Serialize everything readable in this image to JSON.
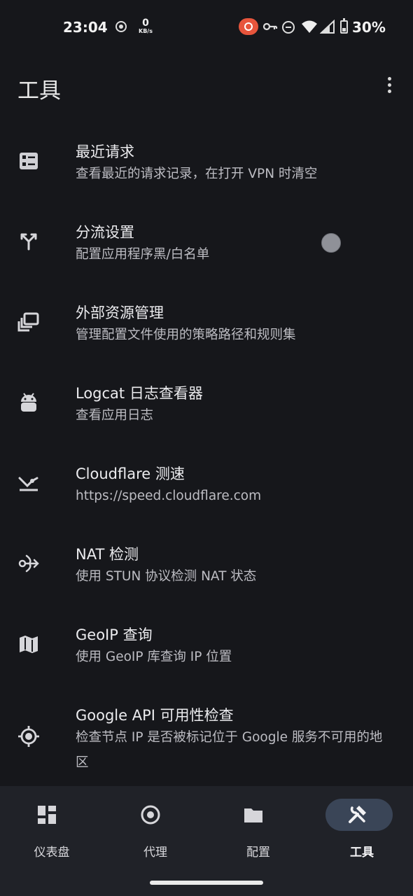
{
  "status_bar": {
    "time": "23:04",
    "net_speed_value": "0",
    "net_speed_unit": "KB/s",
    "battery": "30%",
    "icons": [
      "screen-record-icon",
      "cast-recording-icon",
      "vpn-key-icon",
      "do-not-disturb-icon",
      "wifi-icon",
      "signal-icon",
      "battery-icon"
    ]
  },
  "app_bar": {
    "title": "工具",
    "menu_icon": "more-vert-icon"
  },
  "tools": [
    {
      "icon": "request-list-icon",
      "title": "最近请求",
      "subtitle": "查看最近的请求记录，在打开 VPN 时清空"
    },
    {
      "icon": "call-split-icon",
      "title": "分流设置",
      "subtitle": "配置应用程序黑/白名单"
    },
    {
      "icon": "library-icon",
      "title": "外部资源管理",
      "subtitle": "管理配置文件使用的策略路径和规则集"
    },
    {
      "icon": "android-icon",
      "title": "Logcat 日志查看器",
      "subtitle": "查看应用日志"
    },
    {
      "icon": "speed-test-icon",
      "title": "Cloudflare 测速",
      "subtitle": "https://speed.cloudflare.com"
    },
    {
      "icon": "nat-icon",
      "title": "NAT 检测",
      "subtitle": "使用 STUN 协议检测 NAT 状态"
    },
    {
      "icon": "map-icon",
      "title": "GeoIP 查询",
      "subtitle": "使用 GeoIP 库查询 IP 位置"
    },
    {
      "icon": "gps-target-icon",
      "title": "Google API 可用性检查",
      "subtitle": "检查节点 IP 是否被标记位于 Google 服务不可用的地区"
    }
  ],
  "bottom_nav": [
    {
      "icon": "dashboard-icon",
      "label": "仪表盘",
      "active": false
    },
    {
      "icon": "proxy-icon",
      "label": "代理",
      "active": false
    },
    {
      "icon": "folder-icon",
      "label": "配置",
      "active": false
    },
    {
      "icon": "tools-icon",
      "label": "工具",
      "active": true
    }
  ],
  "colors": {
    "background": "#16171b",
    "nav_background": "#202228",
    "active_pill": "#3a4557",
    "record_badge": "#e7553c"
  }
}
